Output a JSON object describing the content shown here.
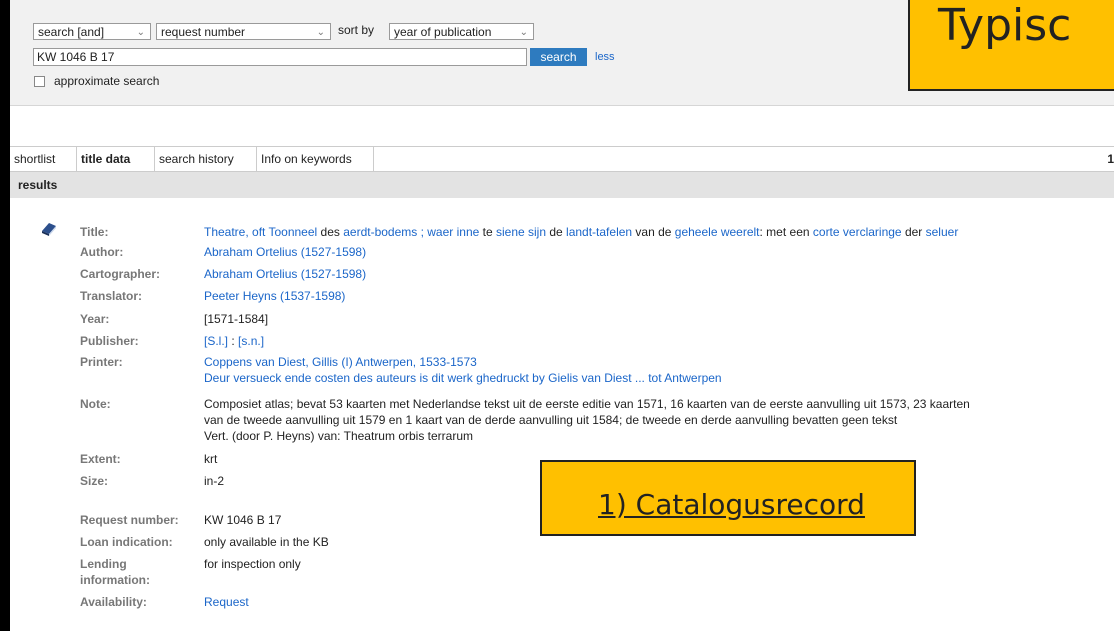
{
  "search": {
    "operator": "search [and]",
    "field": "request number",
    "sort_label": "sort by",
    "sort_value": "year of publication",
    "query": "KW 1046 B 17",
    "button": "search",
    "less": "less",
    "approximate": "approximate search"
  },
  "tabs": [
    "shortlist",
    "title data",
    "search history",
    "Info on keywords"
  ],
  "tab_count": "1",
  "results_label": "results",
  "record": {
    "title_label": "Title:",
    "title_parts": [
      {
        "t": "Theatre, oft Toonneel",
        "link": true
      },
      {
        "t": " des ",
        "link": false
      },
      {
        "t": "aerdt-bodems ; waer inne",
        "link": true
      },
      {
        "t": " te ",
        "link": false
      },
      {
        "t": "siene sijn",
        "link": true
      },
      {
        "t": " de ",
        "link": false
      },
      {
        "t": "landt-tafelen",
        "link": true
      },
      {
        "t": " van de ",
        "link": false
      },
      {
        "t": "geheele weerelt",
        "link": true
      },
      {
        "t": ": met een ",
        "link": false
      },
      {
        "t": "corte verclaringe",
        "link": true
      },
      {
        "t": " der ",
        "link": false
      },
      {
        "t": "seluer",
        "link": true
      }
    ],
    "author_label": "Author:",
    "author": "Abraham Ortelius (1527-1598)",
    "cartographer_label": "Cartographer:",
    "cartographer": "Abraham Ortelius (1527-1598)",
    "translator_label": "Translator:",
    "translator": "Peeter Heyns (1537-1598)",
    "year_label": "Year:",
    "year": "[1571-1584]",
    "publisher_label": "Publisher:",
    "publisher_place": "[S.l.]",
    "publisher_sep": " : ",
    "publisher_name": "[s.n.]",
    "printer_label": "Printer:",
    "printer_line1": "Coppens van Diest, Gillis (I) Antwerpen, 1533-1573",
    "printer_line2": "Deur versueck ende costen des auteurs is dit werk ghedruckt by Gielis van Diest ... tot Antwerpen",
    "note_label": "Note:",
    "note_line1": "Composiet atlas; bevat 53 kaarten met Nederlandse tekst uit de eerste editie van 1571, 16 kaarten van de eerste aanvulling uit 1573, 23 kaarten",
    "note_line2": "van de tweede aanvulling uit 1579 en 1 kaart van de derde aanvulling uit 1584; de tweede en derde aanvulling bevatten geen tekst",
    "note_line3": "Vert. (door P. Heyns) van: Theatrum orbis terrarum",
    "extent_label": "Extent:",
    "extent": "krt",
    "size_label": "Size:",
    "size": "in-2",
    "request_label": "Request number:",
    "request": "KW 1046 B 17",
    "loan_label": "Loan indication:",
    "loan": "only available in the KB",
    "lending_label_1": "Lending",
    "lending_label_2": "information:",
    "lending": "for inspection only",
    "availability_label": "Availability:",
    "availability": "Request"
  },
  "callouts": {
    "top": "Typisc",
    "bottom": "1) Catalogusrecord"
  },
  "colors": {
    "accent": "#ffc000",
    "link": "#1b66c9",
    "button": "#2e7bbf"
  }
}
